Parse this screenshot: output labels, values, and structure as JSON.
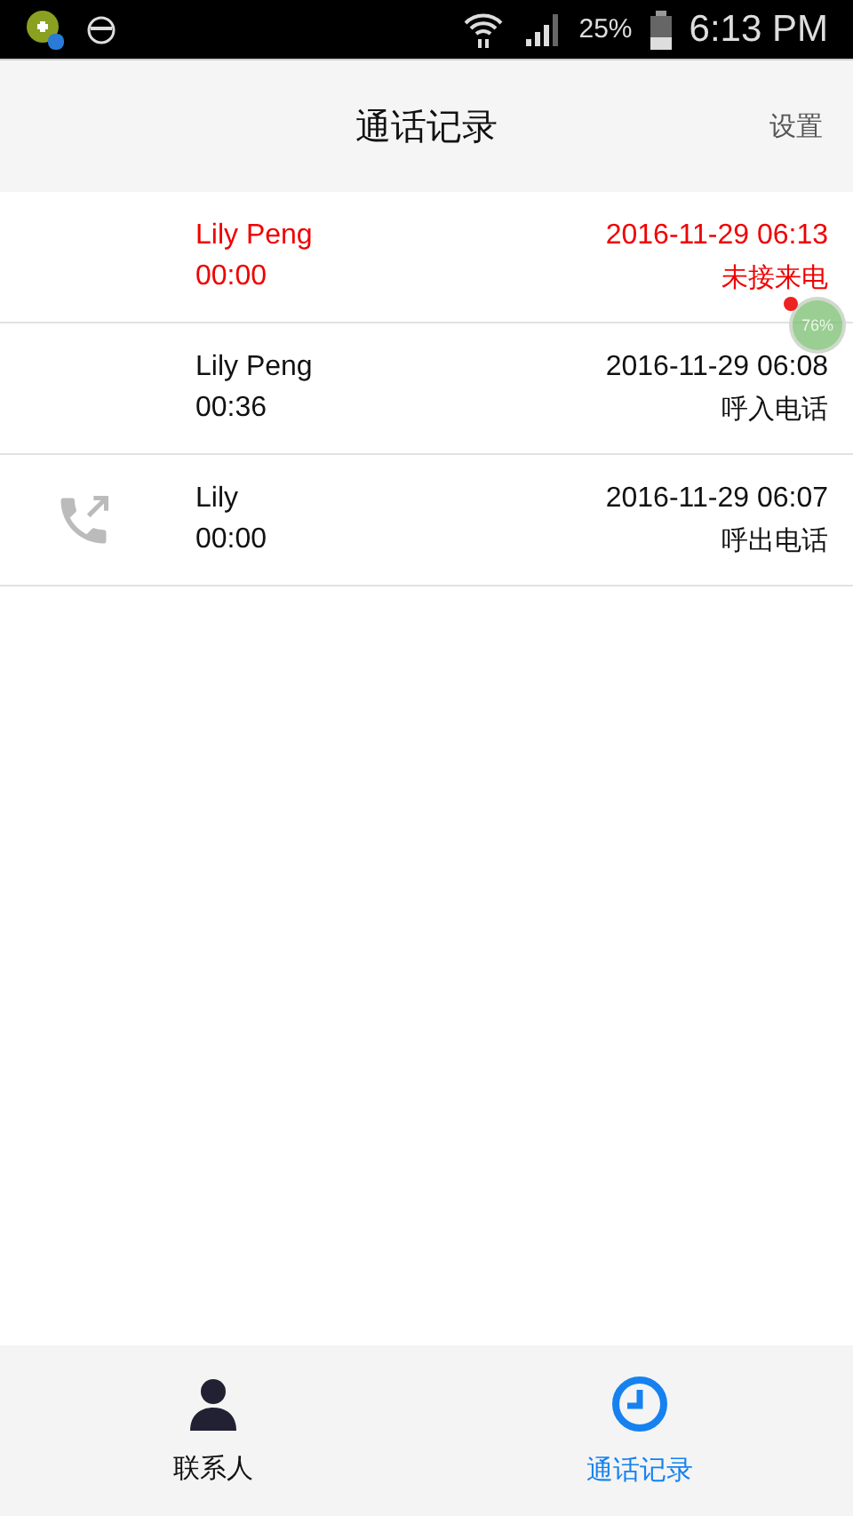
{
  "status_bar": {
    "battery": "25%",
    "time": "6:13 PM"
  },
  "header": {
    "title": "通话记录",
    "action": "设置"
  },
  "calls": [
    {
      "kind": "missed",
      "name": "Lily Peng",
      "duration": "00:00",
      "time": "2016-11-29 06:13",
      "type_label": "未接来电"
    },
    {
      "kind": "incoming",
      "name": "Lily Peng",
      "duration": "00:36",
      "time": "2016-11-29 06:08",
      "type_label": "呼入电话"
    },
    {
      "kind": "outgoing",
      "name": "Lily",
      "duration": "00:00",
      "time": "2016-11-29 06:07",
      "type_label": "呼出电话"
    }
  ],
  "floating_widget": {
    "reading": "76%"
  },
  "tabs": [
    {
      "kind": "contacts",
      "label": "联系人",
      "selected": false
    },
    {
      "kind": "history",
      "label": "通话记录",
      "selected": true
    }
  ]
}
